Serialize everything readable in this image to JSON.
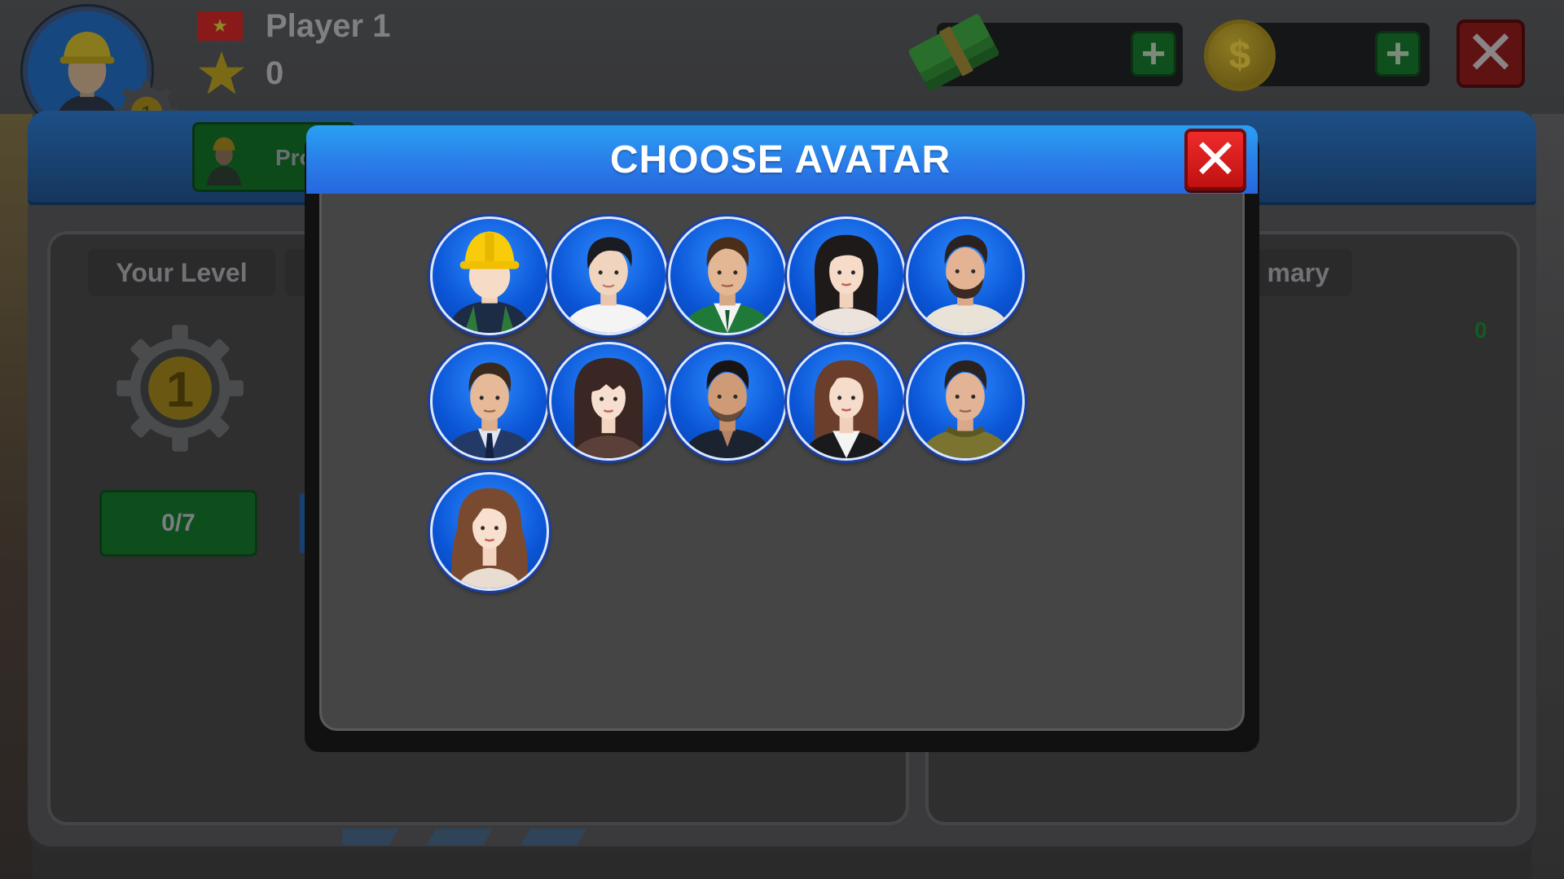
{
  "hud": {
    "player_name": "Player 1",
    "score": "0",
    "player_level": "1",
    "flag_star": "★",
    "coin_symbol": "$",
    "plus": "+",
    "close_symbol": "✕"
  },
  "background_panel": {
    "tab_label": "Pro",
    "your_level_label": "Your Level",
    "summary_label": "mary",
    "level_number": "1",
    "progress": "0/7",
    "right_value": "0"
  },
  "modal": {
    "title": "CHOOSE AVATAR",
    "close_symbol": "✕",
    "avatars": [
      {
        "id": "worker",
        "icon": "construction-worker-icon",
        "selected": true
      },
      {
        "id": "young-man-white-shirt",
        "icon": "young-man-icon"
      },
      {
        "id": "man-green-vest",
        "icon": "man-vest-icon"
      },
      {
        "id": "woman-long-dark-hair",
        "icon": "woman-icon"
      },
      {
        "id": "bearded-man",
        "icon": "bearded-man-icon"
      },
      {
        "id": "man-suit-tie",
        "icon": "businessman-icon"
      },
      {
        "id": "woman-bangs",
        "icon": "woman-bangs-icon"
      },
      {
        "id": "man-dark-shirt",
        "icon": "man-dark-shirt-icon"
      },
      {
        "id": "woman-blazer",
        "icon": "woman-blazer-icon"
      },
      {
        "id": "man-sweater",
        "icon": "man-sweater-icon"
      },
      {
        "id": "woman-wavy-hair",
        "icon": "woman-wavy-hair-icon"
      }
    ]
  },
  "colors": {
    "modal_header": "#2a7de8",
    "avatar_bg": "#0a55d6",
    "close_red": "#d81a1a",
    "panel_gray": "#454546"
  }
}
